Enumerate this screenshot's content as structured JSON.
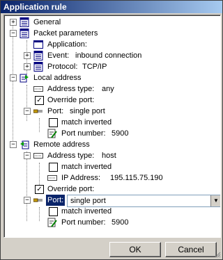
{
  "window": {
    "title": "Application rule"
  },
  "tree": {
    "general": "General",
    "packet_parameters": "Packet parameters",
    "application": "Application:",
    "event_label": "Event:",
    "event_value": "inbound connection",
    "protocol_label": "Protocol:",
    "protocol_value": "TCP/IP",
    "local_address": "Local address",
    "local_address_type_label": "Address type:",
    "local_address_type_value": "any",
    "local_override_port": "Override port:",
    "local_port_label": "Port:",
    "local_port_value": "single port",
    "local_match_inverted": "match inverted",
    "local_port_number_label": "Port number:",
    "local_port_number_value": "5900",
    "remote_address": "Remote address",
    "remote_address_type_label": "Address type:",
    "remote_address_type_value": "host",
    "remote_match_inverted": "match inverted",
    "remote_ip_label": "IP Address:",
    "remote_ip_value": "195.115.75.190",
    "remote_override_port": "Override port:",
    "remote_port_label": "Port:",
    "remote_port_value": "single port",
    "remote_port_match_inverted": "match inverted",
    "remote_port_number_label": "Port number:",
    "remote_port_number_value": "5900"
  },
  "checks": {
    "checked": "✓",
    "unchecked": ""
  },
  "buttons": {
    "ok": "OK",
    "cancel": "Cancel"
  }
}
